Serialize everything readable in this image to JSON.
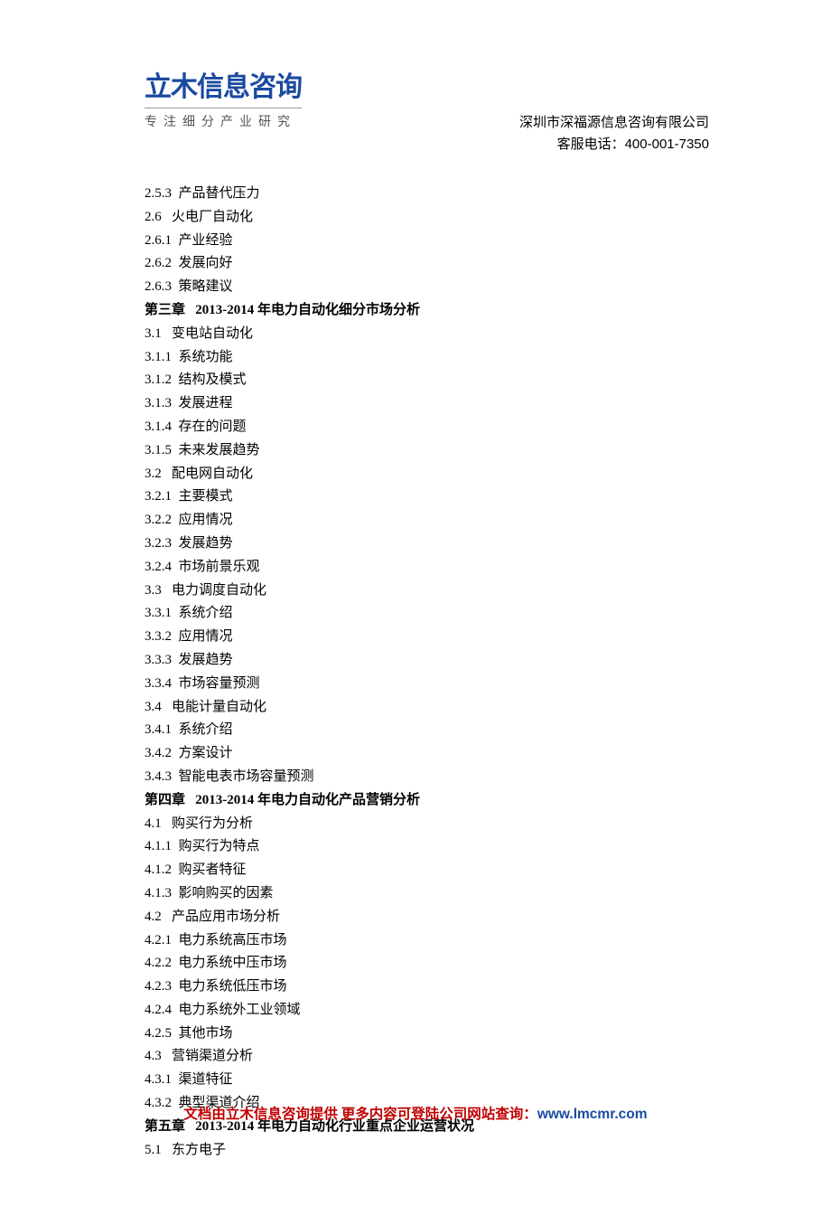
{
  "header": {
    "logo_title": "立木信息咨询",
    "logo_subtitle": "专注细分产业研究",
    "company": "深圳市深福源信息咨询有限公司",
    "phone_label": "客服电话：",
    "phone_number": "400-001-7350"
  },
  "toc": [
    {
      "type": "item",
      "num": "2.5.3",
      "text": "产品替代压力"
    },
    {
      "type": "item",
      "num": "2.6",
      "text": "火电厂自动化"
    },
    {
      "type": "item",
      "num": "2.6.1",
      "text": "产业经验"
    },
    {
      "type": "item",
      "num": "2.6.2",
      "text": "发展向好"
    },
    {
      "type": "item",
      "num": "2.6.3",
      "text": "策略建议"
    },
    {
      "type": "chapter",
      "num": "第三章",
      "text": "2013-2014 年电力自动化细分市场分析"
    },
    {
      "type": "item",
      "num": "3.1",
      "text": "变电站自动化"
    },
    {
      "type": "item",
      "num": "3.1.1",
      "text": "系统功能"
    },
    {
      "type": "item",
      "num": "3.1.2",
      "text": "结构及模式"
    },
    {
      "type": "item",
      "num": "3.1.3",
      "text": "发展进程"
    },
    {
      "type": "item",
      "num": "3.1.4",
      "text": "存在的问题"
    },
    {
      "type": "item",
      "num": "3.1.5",
      "text": "未来发展趋势"
    },
    {
      "type": "item",
      "num": "3.2",
      "text": "配电网自动化"
    },
    {
      "type": "item",
      "num": "3.2.1",
      "text": "主要模式"
    },
    {
      "type": "item",
      "num": "3.2.2",
      "text": "应用情况"
    },
    {
      "type": "item",
      "num": "3.2.3",
      "text": "发展趋势"
    },
    {
      "type": "item",
      "num": "3.2.4",
      "text": "市场前景乐观"
    },
    {
      "type": "item",
      "num": "3.3",
      "text": "电力调度自动化"
    },
    {
      "type": "item",
      "num": "3.3.1",
      "text": "系统介绍"
    },
    {
      "type": "item",
      "num": "3.3.2",
      "text": "应用情况"
    },
    {
      "type": "item",
      "num": "3.3.3",
      "text": "发展趋势"
    },
    {
      "type": "item",
      "num": "3.3.4",
      "text": "市场容量预测"
    },
    {
      "type": "item",
      "num": "3.4",
      "text": "电能计量自动化"
    },
    {
      "type": "item",
      "num": "3.4.1",
      "text": "系统介绍"
    },
    {
      "type": "item",
      "num": "3.4.2",
      "text": "方案设计"
    },
    {
      "type": "item",
      "num": "3.4.3",
      "text": "智能电表市场容量预测"
    },
    {
      "type": "chapter",
      "num": "第四章",
      "text": "2013-2014 年电力自动化产品营销分析"
    },
    {
      "type": "item",
      "num": "4.1",
      "text": "购买行为分析"
    },
    {
      "type": "item",
      "num": "4.1.1",
      "text": "购买行为特点"
    },
    {
      "type": "item",
      "num": "4.1.2",
      "text": "购买者特征"
    },
    {
      "type": "item",
      "num": "4.1.3",
      "text": "影响购买的因素"
    },
    {
      "type": "item",
      "num": "4.2",
      "text": "产品应用市场分析"
    },
    {
      "type": "item",
      "num": "4.2.1",
      "text": "电力系统高压市场"
    },
    {
      "type": "item",
      "num": "4.2.2",
      "text": "电力系统中压市场"
    },
    {
      "type": "item",
      "num": "4.2.3",
      "text": "电力系统低压市场"
    },
    {
      "type": "item",
      "num": "4.2.4",
      "text": "电力系统外工业领域"
    },
    {
      "type": "item",
      "num": "4.2.5",
      "text": "其他市场"
    },
    {
      "type": "item",
      "num": "4.3",
      "text": "营销渠道分析"
    },
    {
      "type": "item",
      "num": "4.3.1",
      "text": "渠道特征"
    },
    {
      "type": "item",
      "num": "4.3.2",
      "text": "典型渠道介绍"
    },
    {
      "type": "chapter",
      "num": "第五章",
      "text": "2013-2014 年电力自动化行业重点企业运营状况"
    },
    {
      "type": "item",
      "num": "5.1",
      "text": "东方电子"
    }
  ],
  "footer": {
    "text": "文档由立木信息咨询提供  更多内容可登陆公司网站查询：",
    "link": "www.lmcmr.com"
  }
}
